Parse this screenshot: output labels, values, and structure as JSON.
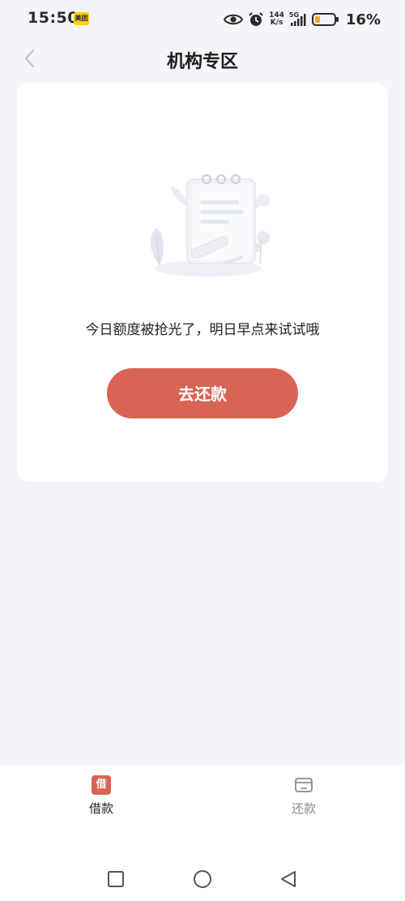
{
  "status_bar": {
    "time": "15:50",
    "app_badge": "美团",
    "speed_value": "144",
    "speed_unit": "K/s",
    "network": "5G",
    "battery_percent": "16%"
  },
  "header": {
    "title": "机构专区"
  },
  "card": {
    "empty_message": "今日额度被抢光了，明日早点来试试哦",
    "button_label": "去还款"
  },
  "bottom_nav": {
    "items": [
      {
        "label": "借款",
        "icon_char": "借",
        "active": true
      },
      {
        "label": "还款",
        "active": false
      }
    ]
  },
  "colors": {
    "accent": "#d86454",
    "background": "#f4f5f9",
    "card": "#ffffff",
    "inactive_text": "#8a8a8a"
  },
  "icons": {
    "back": "chevron-left-icon",
    "eye": "eye-icon",
    "alarm": "alarm-icon",
    "signal": "signal-icon",
    "battery": "battery-icon",
    "borrow": "borrow-icon",
    "repay": "card-icon",
    "recents": "square-icon",
    "home": "circle-icon",
    "sys_back": "triangle-back-icon"
  }
}
